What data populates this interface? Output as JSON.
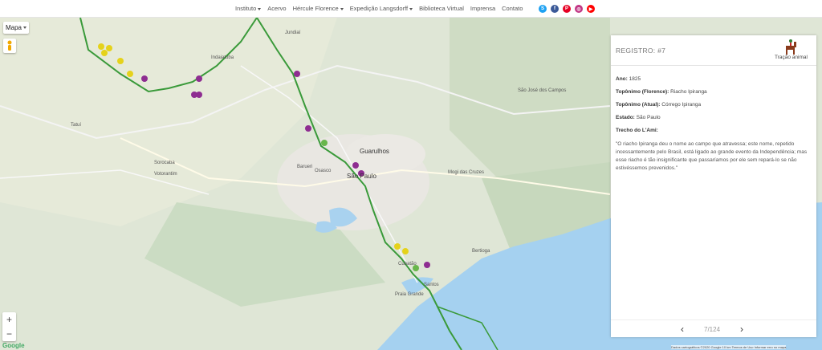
{
  "nav": {
    "items": [
      {
        "label": "Instituto",
        "caret": true
      },
      {
        "label": "Acervo",
        "caret": false
      },
      {
        "label": "Hércule Florence",
        "caret": true
      },
      {
        "label": "Expedição Langsdorff",
        "caret": true
      },
      {
        "label": "Biblioteca Virtual",
        "caret": false
      },
      {
        "label": "Imprensa",
        "caret": false
      },
      {
        "label": "Contato",
        "caret": false
      }
    ],
    "social": [
      {
        "name": "skype-icon",
        "color": "#1da1f2"
      },
      {
        "name": "facebook-icon",
        "color": "#3b5998"
      },
      {
        "name": "pinterest-icon",
        "color": "#e60023"
      },
      {
        "name": "instagram-icon",
        "color": "#c13584"
      },
      {
        "name": "youtube-icon",
        "color": "#ff0000"
      }
    ]
  },
  "map": {
    "type_button": "Mapa",
    "zoom_in": "+",
    "zoom_out": "−",
    "logo": "Google",
    "attribution": "Dados cartográficos ©2020 Google   10 km   Termos de Uso   Informar erro no mapa",
    "cities": [
      {
        "name": "Guarulhos",
        "big": true
      },
      {
        "name": "São Paulo",
        "big": true
      },
      {
        "name": "Osasco",
        "big": false
      },
      {
        "name": "Santos",
        "big": false
      },
      {
        "name": "Sorocaba",
        "big": false
      },
      {
        "name": "Mogi das Cruzes",
        "big": false
      },
      {
        "name": "São José dos Campos",
        "big": false
      },
      {
        "name": "Votorantim",
        "big": false
      },
      {
        "name": "Indaiatuba",
        "big": false
      },
      {
        "name": "Tatuí",
        "big": false
      },
      {
        "name": "Praia Grande",
        "big": false
      },
      {
        "name": "Cubatão",
        "big": false
      },
      {
        "name": "Jundiaí",
        "big": false
      },
      {
        "name": "Barueri",
        "big": false
      },
      {
        "name": "Bertioga",
        "big": false
      }
    ]
  },
  "panel": {
    "title": "REGISTRO: #7",
    "icon_label": "Tração animal",
    "ano_label": "Ano:",
    "ano_value": "1825",
    "top_florence_label": "Topônimo (Florence):",
    "top_florence_value": "Riacho Ipiranga",
    "top_atual_label": "Topônimo (Atual):",
    "top_atual_value": "Córrego Ipiranga",
    "estado_label": "Estado:",
    "estado_value": "São Paulo",
    "trecho_label": "Trecho do L'Ami:",
    "quote": "\"O riacho Ipiranga deu o nome ao campo que atravessa; este nome, repetido incessantemente pelo Brasil, está ligado ao grande evento da Independência; mas esse riacho é tão insignificante que passaríamos por ele sem repará-lo se não estivéssemos prevenidos.\"",
    "counter": "7/124"
  }
}
